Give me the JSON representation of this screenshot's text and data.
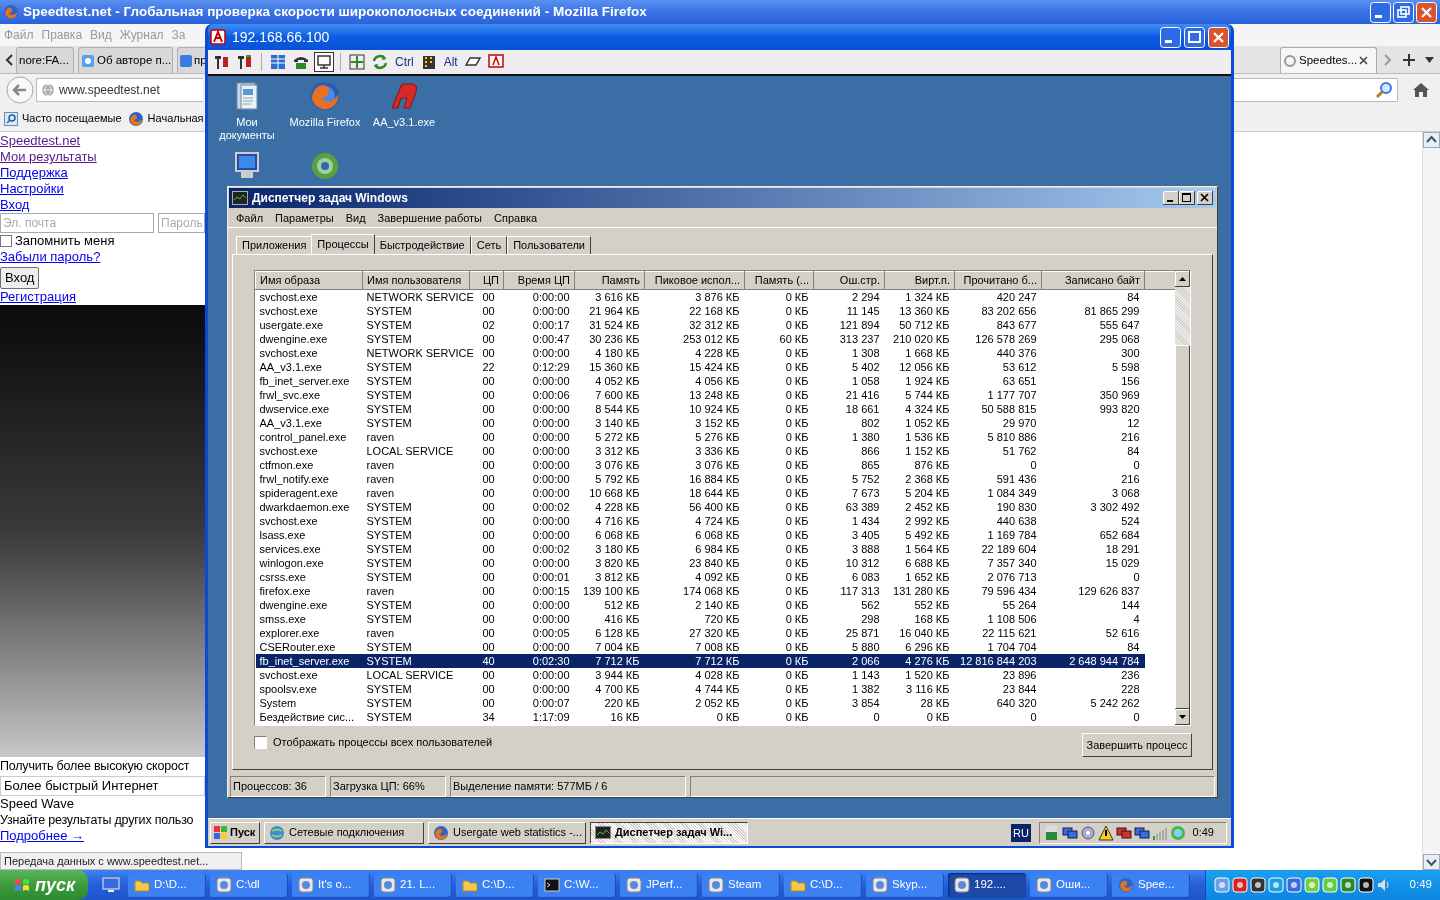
{
  "browser": {
    "title": "Speedtest.net - Глобальная проверка скорости широкополосных соединений - Mozilla Firefox",
    "menu": [
      "Файл",
      "Правка",
      "Вид",
      "Журнал",
      "За"
    ],
    "tabs": [
      {
        "label": "nore:FA...",
        "selected": false
      },
      {
        "label": "Об авторе п...",
        "selected": false
      },
      {
        "label": "пр",
        "selected": false
      },
      {
        "label": "Speedtes...",
        "selected": true
      }
    ],
    "address": "www.speedtest.net",
    "bookmarks": [
      "Часто посещаемые",
      "Начальная"
    ],
    "page": {
      "links": [
        {
          "label": "Speedtest.net",
          "visited": true
        },
        {
          "label": "Мои результаты",
          "visited": true
        },
        {
          "label": "Поддержка",
          "visited": false
        },
        {
          "label": "Настройки",
          "visited": false
        },
        {
          "label": "Вход",
          "visited": false
        }
      ],
      "email_placeholder": "Эл. почта",
      "password_placeholder": "Пароль",
      "remember": {
        "label": "Запомнить меня",
        "checked": false
      },
      "forgot_link": "Забыли пароль?",
      "login_button": "Вход",
      "register_link": "Регистрация",
      "promo_text": "Получить более высокую скорост",
      "promo_field": "Более быстрый Интернет",
      "promo_title": "Speed Wave",
      "promo_desc": "Узнайте результаты других пользо",
      "more_link": "Подробнее →"
    },
    "status": "Передача данных с www.speedtest.net..."
  },
  "remote_window": {
    "title": "192.168.66.100",
    "toolbar_keys": [
      "Ctrl",
      "Alt"
    ],
    "desktop_icons": [
      {
        "kind": "documents",
        "label": "Мои документы"
      },
      {
        "kind": "browser",
        "label": "Mozilla Firefox"
      },
      {
        "kind": "app",
        "label": "AA_v3.1.exe"
      },
      {
        "kind": "computer"
      },
      {
        "kind": "network"
      }
    ],
    "task_manager": {
      "title": "Диспетчер задач Windows",
      "menu": [
        "Файл",
        "Параметры",
        "Вид",
        "Завершение работы",
        "Справка"
      ],
      "tabs": [
        {
          "label": "Приложения",
          "selected": false
        },
        {
          "label": "Процессы",
          "selected": true
        },
        {
          "label": "Быстродействие",
          "selected": false
        },
        {
          "label": "Сеть",
          "selected": false
        },
        {
          "label": "Пользователи",
          "selected": false
        }
      ],
      "columns": [
        "Имя образа",
        "Имя пользователя",
        "ЦП",
        "Время ЦП",
        "Память",
        "Пиковое испол...",
        "Память (...",
        "Ош.стр.",
        "Вирт.п.",
        "Прочитано б...",
        "Записано байт"
      ],
      "rows": [
        {
          "cells": [
            "svchost.exe",
            "NETWORK SERVICE",
            "00",
            "0:00:00",
            "3 616 КБ",
            "3 876 КБ",
            "0 КБ",
            "2 294",
            "1 324 КБ",
            "420 247",
            "84"
          ],
          "selected": false
        },
        {
          "cells": [
            "svchost.exe",
            "SYSTEM",
            "00",
            "0:00:00",
            "21 964 КБ",
            "22 168 КБ",
            "0 КБ",
            "11 145",
            "13 360 КБ",
            "83 202 656",
            "81 865 299"
          ],
          "selected": false
        },
        {
          "cells": [
            "usergate.exe",
            "SYSTEM",
            "02",
            "0:00:17",
            "31 524 КБ",
            "32 312 КБ",
            "0 КБ",
            "121 894",
            "50 712 КБ",
            "843 677",
            "555 647"
          ],
          "selected": false
        },
        {
          "cells": [
            "dwengine.exe",
            "SYSTEM",
            "00",
            "0:00:47",
            "30 236 КБ",
            "253 012 КБ",
            "60 КБ",
            "313 237",
            "210 020 КБ",
            "126 578 269",
            "295 068"
          ],
          "selected": false
        },
        {
          "cells": [
            "svchost.exe",
            "NETWORK SERVICE",
            "00",
            "0:00:00",
            "4 180 КБ",
            "4 228 КБ",
            "0 КБ",
            "1 308",
            "1 668 КБ",
            "440 376",
            "300"
          ],
          "selected": false
        },
        {
          "cells": [
            "AA_v3.1.exe",
            "SYSTEM",
            "22",
            "0:12:29",
            "15 360 КБ",
            "15 424 КБ",
            "0 КБ",
            "5 402",
            "12 056 КБ",
            "53 612",
            "5 598"
          ],
          "selected": false
        },
        {
          "cells": [
            "fb_inet_server.exe",
            "SYSTEM",
            "00",
            "0:00:00",
            "4 052 КБ",
            "4 056 КБ",
            "0 КБ",
            "1 058",
            "1 924 КБ",
            "63 651",
            "156"
          ],
          "selected": false
        },
        {
          "cells": [
            "frwl_svc.exe",
            "SYSTEM",
            "00",
            "0:00:06",
            "7 600 КБ",
            "13 248 КБ",
            "0 КБ",
            "21 416",
            "5 744 КБ",
            "1 177 707",
            "350 969"
          ],
          "selected": false
        },
        {
          "cells": [
            "dwservice.exe",
            "SYSTEM",
            "00",
            "0:00:00",
            "8 544 КБ",
            "10 924 КБ",
            "0 КБ",
            "18 661",
            "4 324 КБ",
            "50 588 815",
            "993 820"
          ],
          "selected": false
        },
        {
          "cells": [
            "AA_v3.1.exe",
            "SYSTEM",
            "00",
            "0:00:00",
            "3 140 КБ",
            "3 152 КБ",
            "0 КБ",
            "802",
            "1 052 КБ",
            "29 970",
            "12"
          ],
          "selected": false
        },
        {
          "cells": [
            "control_panel.exe",
            "raven",
            "00",
            "0:00:00",
            "5 272 КБ",
            "5 276 КБ",
            "0 КБ",
            "1 380",
            "1 536 КБ",
            "5 810 886",
            "216"
          ],
          "selected": false
        },
        {
          "cells": [
            "svchost.exe",
            "LOCAL SERVICE",
            "00",
            "0:00:00",
            "3 312 КБ",
            "3 336 КБ",
            "0 КБ",
            "866",
            "1 152 КБ",
            "51 762",
            "84"
          ],
          "selected": false
        },
        {
          "cells": [
            "ctfmon.exe",
            "raven",
            "00",
            "0:00:00",
            "3 076 КБ",
            "3 076 КБ",
            "0 КБ",
            "865",
            "876 КБ",
            "0",
            "0"
          ],
          "selected": false
        },
        {
          "cells": [
            "frwl_notify.exe",
            "raven",
            "00",
            "0:00:00",
            "5 792 КБ",
            "16 884 КБ",
            "0 КБ",
            "5 752",
            "2 368 КБ",
            "591 436",
            "216"
          ],
          "selected": false
        },
        {
          "cells": [
            "spideragent.exe",
            "raven",
            "00",
            "0:00:00",
            "10 668 КБ",
            "18 644 КБ",
            "0 КБ",
            "7 673",
            "5 204 КБ",
            "1 084 349",
            "3 068"
          ],
          "selected": false
        },
        {
          "cells": [
            "dwarkdaemon.exe",
            "SYSTEM",
            "00",
            "0:00:02",
            "4 228 КБ",
            "56 400 КБ",
            "0 КБ",
            "63 389",
            "2 452 КБ",
            "190 830",
            "3 302 492"
          ],
          "selected": false
        },
        {
          "cells": [
            "svchost.exe",
            "SYSTEM",
            "00",
            "0:00:00",
            "4 716 КБ",
            "4 724 КБ",
            "0 КБ",
            "1 434",
            "2 992 КБ",
            "440 638",
            "524"
          ],
          "selected": false
        },
        {
          "cells": [
            "lsass.exe",
            "SYSTEM",
            "00",
            "0:00:00",
            "6 068 КБ",
            "6 068 КБ",
            "0 КБ",
            "3 405",
            "5 492 КБ",
            "1 169 784",
            "652 684"
          ],
          "selected": false
        },
        {
          "cells": [
            "services.exe",
            "SYSTEM",
            "00",
            "0:00:02",
            "3 180 КБ",
            "6 984 КБ",
            "0 КБ",
            "3 888",
            "1 564 КБ",
            "22 189 604",
            "18 291"
          ],
          "selected": false
        },
        {
          "cells": [
            "winlogon.exe",
            "SYSTEM",
            "00",
            "0:00:00",
            "3 820 КБ",
            "23 840 КБ",
            "0 КБ",
            "10 312",
            "6 688 КБ",
            "7 357 340",
            "15 029"
          ],
          "selected": false
        },
        {
          "cells": [
            "csrss.exe",
            "SYSTEM",
            "00",
            "0:00:01",
            "3 812 КБ",
            "4 092 КБ",
            "0 КБ",
            "6 083",
            "1 652 КБ",
            "2 076 713",
            "0"
          ],
          "selected": false
        },
        {
          "cells": [
            "firefox.exe",
            "raven",
            "00",
            "0:00:15",
            "139 100 КБ",
            "174 068 КБ",
            "0 КБ",
            "117 313",
            "131 280 КБ",
            "79 596 434",
            "129 626 837"
          ],
          "selected": false
        },
        {
          "cells": [
            "dwengine.exe",
            "SYSTEM",
            "00",
            "0:00:00",
            "512 КБ",
            "2 140 КБ",
            "0 КБ",
            "562",
            "552 КБ",
            "55 264",
            "144"
          ],
          "selected": false
        },
        {
          "cells": [
            "smss.exe",
            "SYSTEM",
            "00",
            "0:00:00",
            "416 КБ",
            "720 КБ",
            "0 КБ",
            "298",
            "168 КБ",
            "1 108 506",
            "4"
          ],
          "selected": false
        },
        {
          "cells": [
            "explorer.exe",
            "raven",
            "00",
            "0:00:05",
            "6 128 КБ",
            "27 320 КБ",
            "0 КБ",
            "25 871",
            "16 040 КБ",
            "22 115 621",
            "52 616"
          ],
          "selected": false
        },
        {
          "cells": [
            "CSERouter.exe",
            "SYSTEM",
            "00",
            "0:00:00",
            "7 004 КБ",
            "7 008 КБ",
            "0 КБ",
            "5 880",
            "6 296 КБ",
            "1 704 704",
            "84"
          ],
          "selected": false
        },
        {
          "cells": [
            "fb_inet_server.exe",
            "SYSTEM",
            "40",
            "0:02:30",
            "7 712 КБ",
            "7 712 КБ",
            "0 КБ",
            "2 066",
            "4 276 КБ",
            "12 816 844 203",
            "2 648 944 784"
          ],
          "selected": true
        },
        {
          "cells": [
            "svchost.exe",
            "LOCAL SERVICE",
            "00",
            "0:00:00",
            "3 944 КБ",
            "4 028 КБ",
            "0 КБ",
            "1 143",
            "1 520 КБ",
            "23 896",
            "236"
          ],
          "selected": false
        },
        {
          "cells": [
            "spoolsv.exe",
            "SYSTEM",
            "00",
            "0:00:00",
            "4 700 КБ",
            "4 744 КБ",
            "0 КБ",
            "1 382",
            "3 116 КБ",
            "23 844",
            "228"
          ],
          "selected": false
        },
        {
          "cells": [
            "System",
            "SYSTEM",
            "00",
            "0:00:07",
            "220 КБ",
            "2 052 КБ",
            "0 КБ",
            "3 854",
            "28 КБ",
            "640 320",
            "5 242 262"
          ],
          "selected": false
        },
        {
          "cells": [
            "Бездействие сис...",
            "SYSTEM",
            "34",
            "1:17:09",
            "16 КБ",
            "0 КБ",
            "0 КБ",
            "0",
            "0 КБ",
            "0",
            "0"
          ],
          "selected": false
        }
      ],
      "show_all": {
        "label": "Отображать процессы всех пользователей",
        "checked": false
      },
      "end_button": "Завершить процесс",
      "status": [
        "Процессов: 36",
        "Загрузка ЦП: 66%",
        "Выделение памяти: 577МБ / 6"
      ]
    },
    "taskbar": {
      "start": "Пуск",
      "buttons": [
        {
          "kind": "network",
          "label": "Сетевые подключения",
          "selected": false
        },
        {
          "kind": "browser",
          "label": "Usergate web statistics -...",
          "selected": false
        },
        {
          "kind": "monitor",
          "label": "Диспетчер задач Wi...",
          "selected": true
        }
      ],
      "language": "RU",
      "clock": "0:49"
    }
  },
  "taskbar": {
    "start": "пуск",
    "buttons": [
      {
        "kind": "folder",
        "label": "D:\\D...",
        "selected": false
      },
      {
        "kind": "app",
        "label": "C:\\dl",
        "selected": false
      },
      {
        "kind": "app",
        "label": "It's o...",
        "selected": false
      },
      {
        "kind": "app",
        "label": "21. L...",
        "selected": false
      },
      {
        "kind": "folder",
        "label": "C:\\D...",
        "selected": false
      },
      {
        "kind": "console",
        "label": "C:\\W...",
        "selected": false
      },
      {
        "kind": "app",
        "label": "JPerf...",
        "selected": false
      },
      {
        "kind": "app",
        "label": "Steam",
        "selected": false
      },
      {
        "kind": "folder",
        "label": "C:\\D...",
        "selected": false
      },
      {
        "kind": "app",
        "label": "Skyp...",
        "selected": false
      },
      {
        "kind": "app",
        "label": "192....",
        "selected": true
      },
      {
        "kind": "app",
        "label": "Оши...",
        "selected": false
      },
      {
        "kind": "browser",
        "label": "Spee...",
        "selected": false
      }
    ],
    "clock": "0:49"
  }
}
